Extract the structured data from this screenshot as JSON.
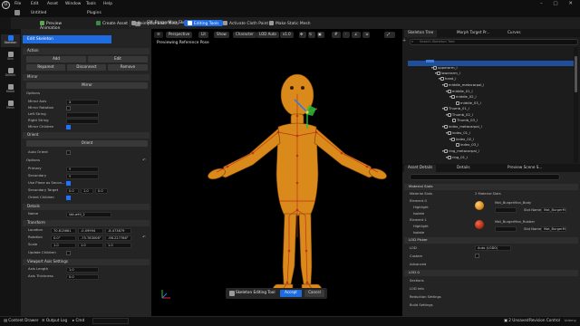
{
  "app": {
    "logo": "U",
    "project": "Untitled"
  },
  "menu": [
    "File",
    "Edit",
    "Asset",
    "Window",
    "Tools",
    "Help"
  ],
  "tabs": {
    "plugins": "Plugins",
    "asset_tab": "SM_BurgerMan_SkelM..."
  },
  "toolbar": {
    "preview_animation": "Preview Animation",
    "create_asset": "Create Asset",
    "reimport": "Reimport Base Mesh",
    "editing_tools": "Editing Tools",
    "activate_cloth": "Activate Cloth Paint",
    "make_static": "Make Static Mesh"
  },
  "modes": [
    "Skeleton",
    "Skin",
    "Deform",
    "Model",
    "Mesh"
  ],
  "left_panel": {
    "header": "Edit Skeleton",
    "action_section": "Action",
    "add": "Add",
    "edit": "Edit",
    "reparent": "Reparent",
    "disconnect": "Disconnect",
    "remove": "Remove",
    "mirror_section": "Mirror",
    "mirror_button": "Mirror",
    "options_label": "Options",
    "mirror_axis_label": "Mirror Axis",
    "mirror_axis_value": "X",
    "mirror_rotation_label": "Mirror Rotation",
    "left_string_label": "Left String",
    "right_string_label": "Right String",
    "mirror_children_label": "Mirror Children",
    "orient_section": "Orient",
    "orient_button": "Orient",
    "auto_orient_label": "Auto Orient",
    "orient_options_label": "Options",
    "primary_label": "Primary",
    "primary_value": "Y",
    "secondary_label": "Secondary",
    "secondary_value": "Y",
    "use_plane_label": "Use Plane as Secon...",
    "secondary_target_label": "Secondary Target",
    "secondary_target": [
      "0.0",
      "1.0",
      "0.0"
    ],
    "orient_children_label": "Orient Children",
    "details_section": "Details",
    "name_label": "Name",
    "name_value": "ValueHi_2",
    "transform_section": "Transform",
    "location_label": "Location",
    "location": [
      "70.613661",
      "-0.09994",
      "-8.473879"
    ],
    "rotation_label": "Rotation",
    "rotation": [
      "0.0°",
      "-75.783006°",
      "-98.227786°"
    ],
    "scale_label": "Scale",
    "scale": [
      "1.0",
      "1.0",
      "1.0"
    ],
    "update_children_label": "Update Children",
    "viewport_axis_section": "Viewport Axis Settings",
    "axis_length_label": "Axis Length",
    "axis_length_value": "1.0",
    "axis_thickness_label": "Axis Thickness",
    "axis_thickness_value": "0.0"
  },
  "viewport": {
    "perspective": "Perspective",
    "lit": "Lit",
    "show": "Show",
    "character": "Character",
    "lod": "LOD Auto",
    "speed": "x1.0",
    "caption": "Previewing Reference Pose",
    "edit_label": "Skeleton Editing Tool",
    "accept": "Accept",
    "cancel": "Cancel"
  },
  "right_panel": {
    "tab_tree": "Skeleton Tree",
    "tab_morph": "Morph Target Pr...",
    "tab_curves": "Curves",
    "search_placeholder": "Search Skeleton Tree",
    "bones": [
      "upperarm_l",
      "lowerarm_l",
      "hand_l",
      "middle_metacarpal_l",
      "middle_01_l",
      "middle_02_l",
      "middle_03_l",
      "Thumb_01_l",
      "Thumb_02_l",
      "Thumb_03_l",
      "index_metacarpal_l",
      "index_01_l",
      "index_02_l",
      "index_03_l",
      "ring_metacarpal_l",
      "ring_01_l"
    ]
  },
  "details": {
    "tab_asset": "Asset Details",
    "tab_details": "Details",
    "tab_preview": "Preview Scene S...",
    "material_slots": "Material Slots",
    "material_slots_label": "Material Slots",
    "material_slots_count": "2 Material Slots",
    "element0": "Element 0",
    "element1": "Element 1",
    "highlight": "Highlight",
    "isolate": "Isolate",
    "mat0": "Mat_BurgerMan_Body",
    "mat1": "Mat_BurgerMan_Rubber",
    "slot_name_label": "Slot Name",
    "slot0": "Mat_BurgerM",
    "slot1": "Mat_BurgerM",
    "lod_picker": "LOD Picker",
    "lod_label": "LOD",
    "lod_value": "Auto (LOD0)",
    "custom_label": "Custom",
    "advanced": "Advanced",
    "lod0": "LOD 0",
    "sections": "Sections",
    "lod_info": "LOD Info",
    "reduction": "Reduction Settings",
    "build": "Build Settings"
  },
  "status": {
    "content_drawer": "Content Drawer",
    "output_log": "Output Log",
    "cmd": "Cmd",
    "unsaved": "2 Unsaved",
    "revision": "Revision Control",
    "watermark": "Udemy"
  },
  "colors": {
    "accent": "#1f6be0",
    "body": "#d98a1a",
    "joint": "#c0311d"
  }
}
